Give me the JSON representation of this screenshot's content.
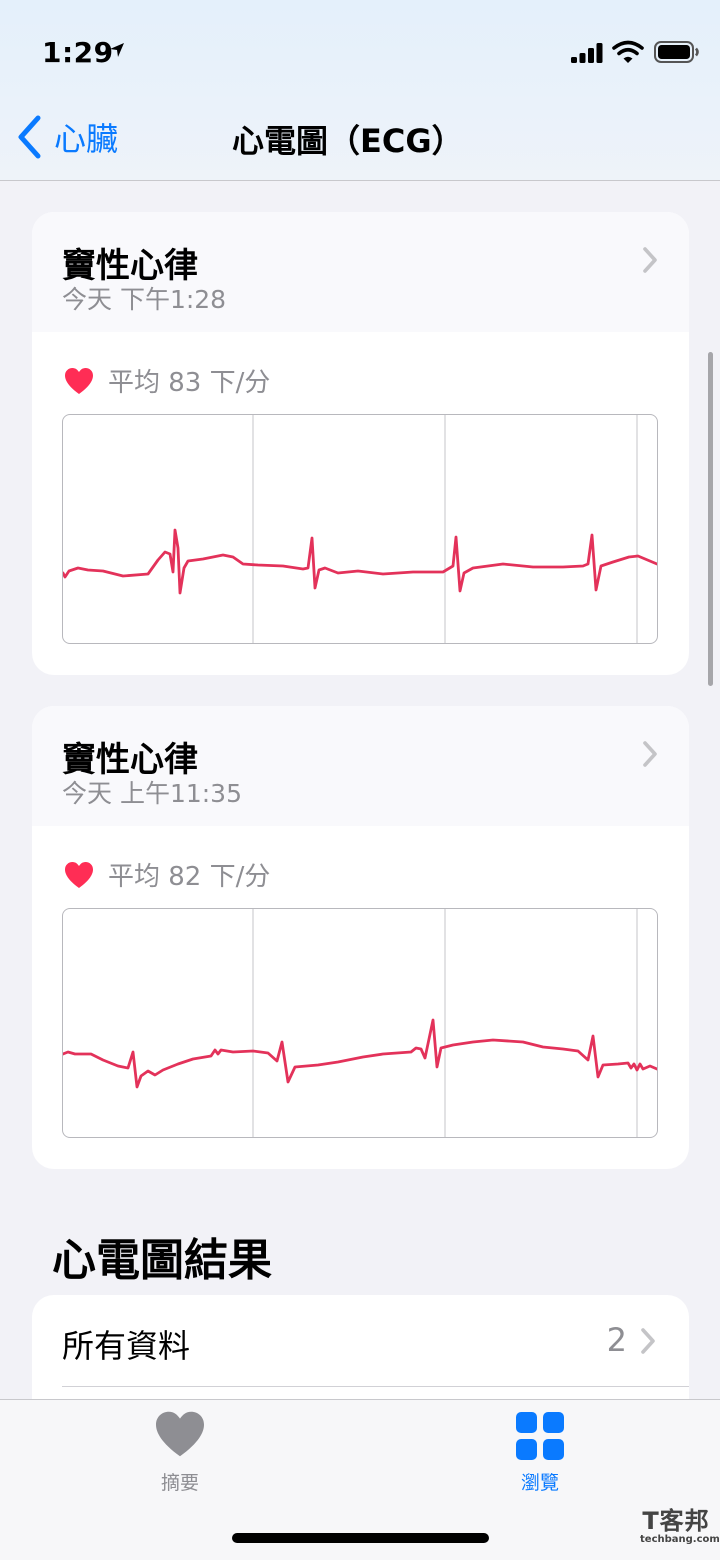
{
  "status_bar": {
    "time": "1:29"
  },
  "nav": {
    "back_label": "心臟",
    "title": "心電圖（ECG）"
  },
  "recordings": [
    {
      "title": "竇性心律",
      "datetime": "今天 下午1:28",
      "avg_heart_rate": "平均 83 下/分",
      "ecg_trace": [
        [
          0,
          -5
        ],
        [
          2,
          -9
        ],
        [
          6,
          -3
        ],
        [
          15,
          0
        ],
        [
          25,
          -2
        ],
        [
          40,
          -3
        ],
        [
          60,
          -8
        ],
        [
          85,
          -6
        ],
        [
          95,
          8
        ],
        [
          102,
          16
        ],
        [
          107,
          14
        ],
        [
          110,
          -4
        ],
        [
          112,
          38
        ],
        [
          115,
          20
        ],
        [
          117,
          -25
        ],
        [
          121,
          0
        ],
        [
          125,
          7
        ],
        [
          140,
          9
        ],
        [
          160,
          13
        ],
        [
          170,
          11
        ],
        [
          180,
          4
        ],
        [
          195,
          3
        ],
        [
          220,
          2
        ],
        [
          240,
          -1
        ],
        [
          245,
          0
        ],
        [
          249,
          30
        ],
        [
          252,
          -20
        ],
        [
          256,
          -2
        ],
        [
          262,
          0
        ],
        [
          275,
          -5
        ],
        [
          295,
          -3
        ],
        [
          320,
          -6
        ],
        [
          350,
          -4
        ],
        [
          380,
          -4
        ],
        [
          390,
          2
        ],
        [
          393,
          31
        ],
        [
          397,
          -23
        ],
        [
          401,
          -5
        ],
        [
          410,
          0
        ],
        [
          440,
          4
        ],
        [
          470,
          1
        ],
        [
          500,
          1
        ],
        [
          520,
          2
        ],
        [
          525,
          4
        ],
        [
          529,
          33
        ],
        [
          533,
          -22
        ],
        [
          538,
          2
        ],
        [
          550,
          6
        ],
        [
          566,
          11
        ],
        [
          575,
          12
        ],
        [
          594,
          4
        ]
      ]
    },
    {
      "title": "竇性心律",
      "datetime": "今天 上午11:35",
      "avg_heart_rate": "平均 82 下/分",
      "ecg_trace": [
        [
          0,
          8
        ],
        [
          5,
          10
        ],
        [
          12,
          8
        ],
        [
          28,
          8
        ],
        [
          40,
          2
        ],
        [
          55,
          -4
        ],
        [
          65,
          -6
        ],
        [
          70,
          10
        ],
        [
          74,
          -25
        ],
        [
          78,
          -14
        ],
        [
          85,
          -9
        ],
        [
          92,
          -13
        ],
        [
          100,
          -8
        ],
        [
          115,
          -2
        ],
        [
          130,
          3
        ],
        [
          148,
          6
        ],
        [
          152,
          12
        ],
        [
          155,
          8
        ],
        [
          158,
          12
        ],
        [
          170,
          10
        ],
        [
          190,
          11
        ],
        [
          205,
          9
        ],
        [
          214,
          1
        ],
        [
          219,
          20
        ],
        [
          225,
          -20
        ],
        [
          232,
          -5
        ],
        [
          255,
          -3
        ],
        [
          275,
          0
        ],
        [
          300,
          5
        ],
        [
          320,
          8
        ],
        [
          348,
          10
        ],
        [
          353,
          14
        ],
        [
          358,
          13
        ],
        [
          362,
          4
        ],
        [
          366,
          23
        ],
        [
          370,
          42
        ],
        [
          374,
          -5
        ],
        [
          378,
          14
        ],
        [
          390,
          17
        ],
        [
          410,
          20
        ],
        [
          430,
          22
        ],
        [
          460,
          20
        ],
        [
          480,
          15
        ],
        [
          500,
          13
        ],
        [
          515,
          11
        ],
        [
          525,
          2
        ],
        [
          530,
          26
        ],
        [
          535,
          -15
        ],
        [
          540,
          -3
        ],
        [
          555,
          -2
        ],
        [
          565,
          -1
        ],
        [
          568,
          -6
        ],
        [
          571,
          -2
        ],
        [
          574,
          -8
        ],
        [
          577,
          -2
        ],
        [
          580,
          -7
        ],
        [
          587,
          -4
        ],
        [
          594,
          -7
        ]
      ]
    }
  ],
  "results_section": {
    "title": "心電圖結果",
    "all_data_label": "所有資料",
    "all_data_count": "2"
  },
  "tab_bar": {
    "summary_label": "摘要",
    "browse_label": "瀏覽"
  },
  "watermark": {
    "line1": "T客邦",
    "line2": "techbang.com"
  },
  "colors": {
    "accent": "#0a7aff",
    "heart": "#ff2d55",
    "ecg_line": "#e3325a",
    "secondary_text": "#8e8e93"
  }
}
